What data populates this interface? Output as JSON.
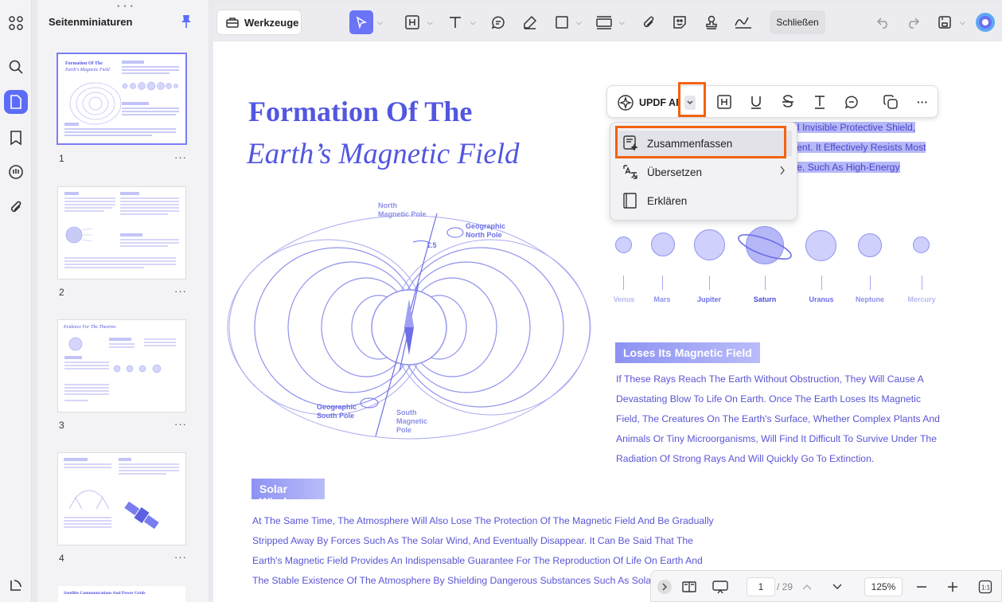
{
  "sidebar": {
    "header": "Seitenminiaturen",
    "pages": [
      "1",
      "2",
      "3",
      "4"
    ],
    "more": "···",
    "thumb_titles": {
      "t1a": "Formation Of The",
      "t1b": "Earth's Magnetic Field",
      "t3": "Evidence For The Theories",
      "t5": "Satellite Communications And Power Grids"
    }
  },
  "toolbar": {
    "tools_label": "Werkzeuge",
    "close_label": "Schließen"
  },
  "document": {
    "title_line1": "Formation Of The",
    "title_line2": "Earth’s Magnetic Field",
    "highlight_lines": [
      "nd Invisible Protective Shield,",
      "ment. It Effectively Resists Most",
      "rse, Such As High-Energy"
    ],
    "planets": [
      "Venus",
      "Mars",
      "Jupiter",
      "Saturn",
      "Uranus",
      "Neptune",
      "Mercury"
    ],
    "section2_title": "Loses Its Magnetic Field",
    "section2_lines": [
      "If These Rays Reach The Earth Without Obstruction, They Will Cause A",
      "Devastating Blow To Life On Earth. Once The Earth Loses Its Magnetic",
      "Field, The Creatures On The Earth's Surface, Whether Complex Plants And",
      "Animals Or Tiny Microorganisms, Will Find It Difficult To Survive Under The",
      "Radiation Of Strong Rays And Will Quickly Go To Extinction."
    ],
    "section3_title": "Solar Wind",
    "section3_lines": [
      "At The Same Time, The Atmosphere Will Also Lose The Protection Of The Magnetic Field And Be Gradually",
      "Stripped Away By Forces Such As The Solar Wind, And Eventually Disappear. It Can Be Said That The",
      "Earth's Magnetic Field Provides An Indispensable Guarantee For The Reproduction Of Life On Earth And",
      "The Stable Existence Of The Atmosphere By Shielding Dangerous Substances Such As Solar Pa"
    ],
    "diagram": {
      "north_magnetic": [
        "North",
        "Magnetic Pole"
      ],
      "geo_north": [
        "Geographic",
        "North Pole"
      ],
      "geo_south": [
        "Geographic",
        "South Pole"
      ],
      "south_magnetic": [
        "South",
        "Magnetic",
        "Pole"
      ],
      "angle": "1.5"
    }
  },
  "selection_bar": {
    "ai_label": "UPDF AI"
  },
  "ai_menu": {
    "items": [
      "Zusammenfassen",
      "Übersetzen",
      "Erklären"
    ]
  },
  "bottom_bar": {
    "current_page": "1",
    "total": "/ 29",
    "zoom": "125%"
  },
  "colors": {
    "accent": "#5b6cf9",
    "doc_text": "#5a55d6",
    "highlight": "#b6b8f7",
    "callout": "#f2620f"
  }
}
